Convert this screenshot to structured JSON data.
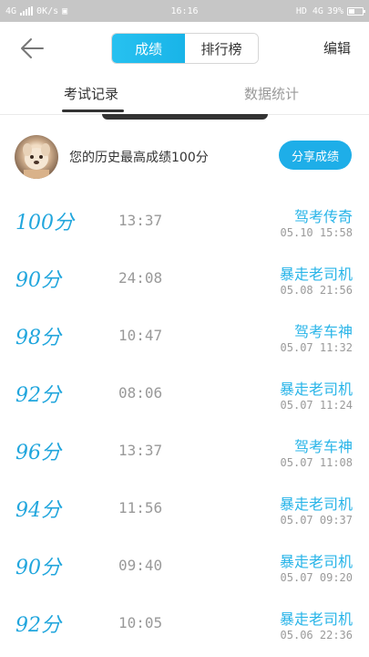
{
  "status_bar": {
    "network": "4G",
    "speed": "0K/s",
    "time": "16:16",
    "hd_net": "HD 4G",
    "battery": "39%"
  },
  "header": {
    "tabs": [
      "成绩",
      "排行榜"
    ],
    "edit_label": "编辑"
  },
  "subtabs": [
    "考试记录",
    "数据统计"
  ],
  "best": {
    "text": "您的历史最高成绩100分",
    "share_label": "分享成绩"
  },
  "records": [
    {
      "score": "100分",
      "duration": "13:37",
      "title": "驾考传奇",
      "datetime": "05.10  15:58"
    },
    {
      "score": "90分",
      "duration": "24:08",
      "title": "暴走老司机",
      "datetime": "05.08  21:56"
    },
    {
      "score": "98分",
      "duration": "10:47",
      "title": "驾考车神",
      "datetime": "05.07  11:32"
    },
    {
      "score": "92分",
      "duration": "08:06",
      "title": "暴走老司机",
      "datetime": "05.07  11:24"
    },
    {
      "score": "96分",
      "duration": "13:37",
      "title": "驾考车神",
      "datetime": "05.07  11:08"
    },
    {
      "score": "94分",
      "duration": "11:56",
      "title": "暴走老司机",
      "datetime": "05.07  09:37"
    },
    {
      "score": "90分",
      "duration": "09:40",
      "title": "暴走老司机",
      "datetime": "05.07  09:20"
    },
    {
      "score": "92分",
      "duration": "10:05",
      "title": "暴走老司机",
      "datetime": "05.06  22:36"
    }
  ],
  "colors": {
    "accent": "#1eaee8",
    "score": "#21a6dd"
  }
}
